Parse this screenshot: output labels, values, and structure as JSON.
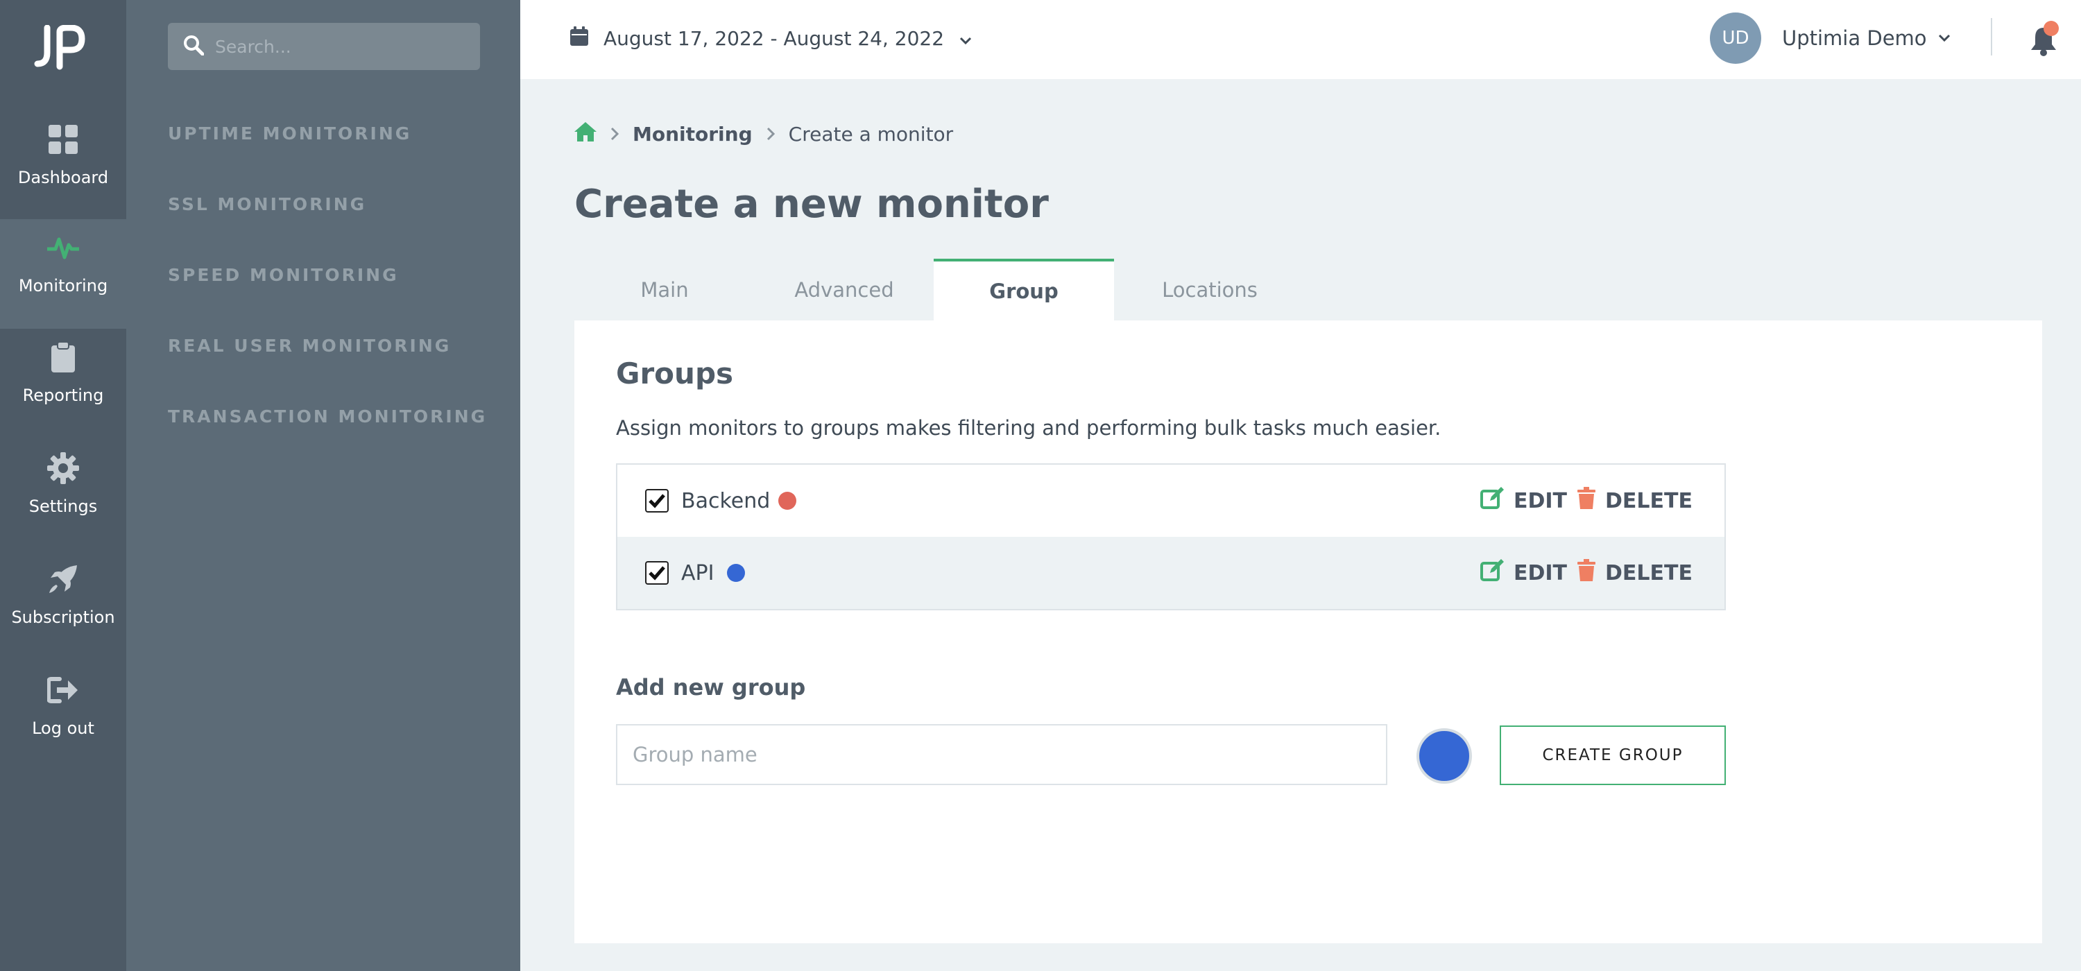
{
  "rail": {
    "items": [
      {
        "label": "Dashboard",
        "icon": "dashboard-grid-icon"
      },
      {
        "label": "Monitoring",
        "icon": "heartbeat-icon",
        "active": true
      },
      {
        "label": "Reporting",
        "icon": "clipboard-icon"
      },
      {
        "label": "Settings",
        "icon": "gear-icon"
      },
      {
        "label": "Subscription",
        "icon": "rocket-icon"
      },
      {
        "label": "Log out",
        "icon": "logout-icon"
      }
    ]
  },
  "subnav": {
    "search_placeholder": "Search...",
    "items": [
      {
        "label": "UPTIME MONITORING"
      },
      {
        "label": "SSL MONITORING"
      },
      {
        "label": "SPEED MONITORING"
      },
      {
        "label": "REAL USER MONITORING"
      },
      {
        "label": "TRANSACTION MONITORING"
      }
    ]
  },
  "topbar": {
    "date_range": "August 17, 2022 - August 24, 2022",
    "user_initials": "UD",
    "user_name": "Uptimia Demo"
  },
  "breadcrumb": {
    "parent": "Monitoring",
    "current": "Create a monitor"
  },
  "page_title": "Create a new monitor",
  "tabs": [
    {
      "label": "Main"
    },
    {
      "label": "Advanced"
    },
    {
      "label": "Group",
      "active": true
    },
    {
      "label": "Locations"
    }
  ],
  "groups": {
    "title": "Groups",
    "description": "Assign monitors to groups makes filtering and performing bulk tasks much easier.",
    "edit_label": "EDIT",
    "delete_label": "DELETE",
    "rows": [
      {
        "name": "Backend",
        "color": "#e0665a",
        "checked": true
      },
      {
        "name": "API",
        "color": "#3567d4",
        "checked": true
      }
    ]
  },
  "add_group": {
    "title": "Add new group",
    "input_placeholder": "Group name",
    "selected_color": "#3567d4",
    "button_label": "CREATE GROUP"
  },
  "colors": {
    "accent_green": "#43b074",
    "delete_red": "#ef7f62"
  }
}
